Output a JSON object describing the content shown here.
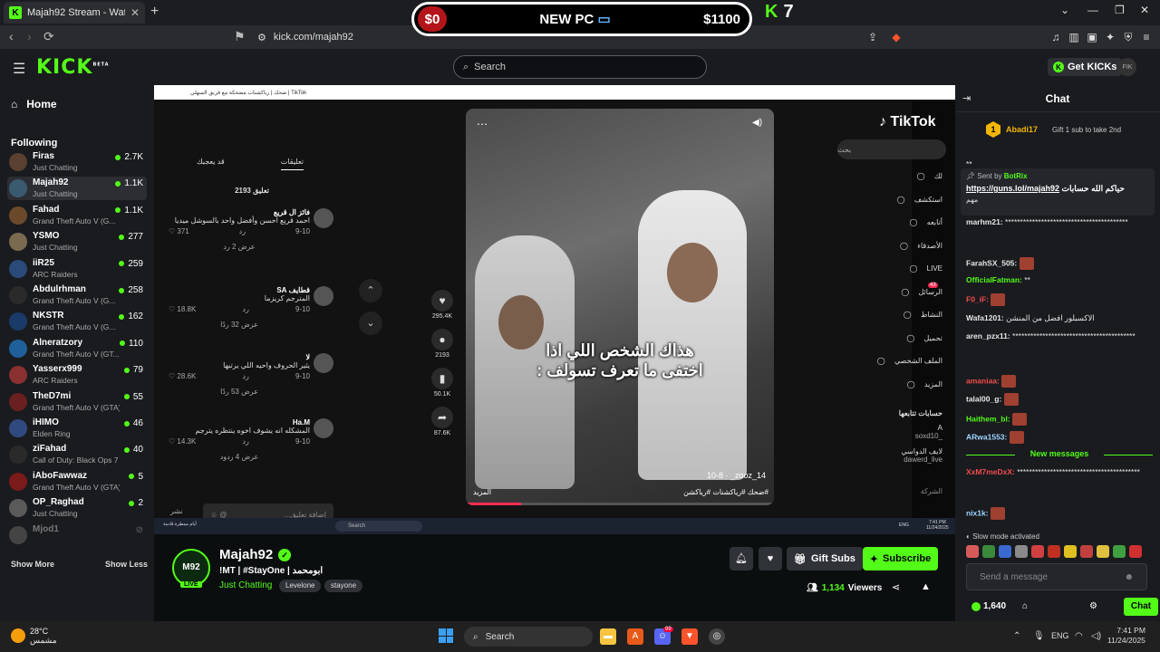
{
  "browser": {
    "tab_title": "Majah92 Stream - Watch Live",
    "tab_close": "✕",
    "new_tab": "+",
    "url": "kick.com/majah92",
    "win_min": "—",
    "win_max": "❐",
    "win_close": "✕",
    "chevron": "⌄"
  },
  "overlay": {
    "left_amount": "$0",
    "middle": "NEW PC",
    "right_amount": "$1100",
    "k_count": "7"
  },
  "header": {
    "logo": "KICK",
    "logo_sup": "BETA",
    "search_placeholder": "Search",
    "get_kicks": "Get KICKs"
  },
  "sidebar": {
    "home": "Home",
    "following": "Following",
    "channels": [
      {
        "name": "Firas",
        "category": "Just Chatting",
        "viewers": "2.7K",
        "live": true
      },
      {
        "name": "Majah92",
        "category": "Just Chatting",
        "viewers": "1.1K",
        "live": true,
        "active": true
      },
      {
        "name": "Fahad",
        "category": "Grand Theft Auto V (G...",
        "viewers": "1.1K",
        "live": true
      },
      {
        "name": "YSMO",
        "category": "Just Chatting",
        "viewers": "277",
        "live": true
      },
      {
        "name": "iiR25",
        "category": "ARC Raiders",
        "viewers": "259",
        "live": true
      },
      {
        "name": "Abdulrhman",
        "category": "Grand Theft Auto V (G...",
        "viewers": "258",
        "live": true
      },
      {
        "name": "NKSTR",
        "category": "Grand Theft Auto V (G...",
        "viewers": "162",
        "live": true
      },
      {
        "name": "Alneratzory",
        "category": "Grand Theft Auto V (GT...",
        "viewers": "110",
        "live": true
      },
      {
        "name": "Yasserx999",
        "category": "ARC Raiders",
        "viewers": "79",
        "live": true
      },
      {
        "name": "TheD7mi",
        "category": "Grand Theft Auto V (GTA)",
        "viewers": "55",
        "live": true
      },
      {
        "name": "iHIMO",
        "category": "Elden Ring",
        "viewers": "46",
        "live": true
      },
      {
        "name": "ziFahad",
        "category": "Call of Duty: Black Ops 7",
        "viewers": "40",
        "live": true
      },
      {
        "name": "iAboFawwaz",
        "category": "Grand Theft Auto V (GTA)",
        "viewers": "5",
        "live": true
      },
      {
        "name": "OP_Raghad",
        "category": "Just Chatting",
        "viewers": "2",
        "live": true
      },
      {
        "name": "Mjod1",
        "category": "",
        "viewers": "",
        "live": false
      }
    ],
    "show_more": "Show More",
    "show_less": "Show Less"
  },
  "stream": {
    "inner_title": "ضحك | رياكشنات مضحكة مع فريق السهلي | TikTok",
    "tiktok": {
      "tab_comments": "تعليقات",
      "tab_liked": "قد يعجبك",
      "comment_count": "2193 تعليق",
      "comments": [
        {
          "user": "فائز ال قريع",
          "text": "احمد قريع احسن وأفضل واحد بالسوشل ميديا",
          "date": "9-10",
          "reply": "رد",
          "likes": "371",
          "replies": "عرض 2 رد"
        },
        {
          "user": "قطايف SA",
          "text": "المترجم كريزما",
          "date": "9-10",
          "reply": "رد",
          "likes": "18.8K",
          "replies": "عرض 32 ردًا"
        },
        {
          "user": "لا",
          "text": "يثير الحروف واحيه اللي يرتبها",
          "date": "9-10",
          "reply": "رد",
          "likes": "28.6K",
          "replies": "عرض 53 ردًا"
        },
        {
          "user": "Ha.M",
          "text": "المشكله انه يشوف اخوه ينتظره يترجم",
          "date": "9-10",
          "reply": "رد",
          "likes": "14.3K",
          "replies": "عرض 4 ردود"
        }
      ],
      "comment_placeholder": "إضافة تعليق...",
      "share_label": "نشر",
      "caption_line1": "هذاك الشخص اللي اذا",
      "caption_line2": "اختفى ما تعرف تسولف :",
      "video_user": "_zooz_14",
      "video_date": "10-8",
      "hashtags": "#ضحك #رياكشنات #رياكشن",
      "more": "المزيد",
      "likes": "295.4K",
      "comments_count": "2193",
      "saves": "50.1K",
      "shares": "87.6K",
      "logo": "TikTok",
      "search": "بحث",
      "nav": [
        "لك",
        "استكشف",
        "أتابعه",
        "الأصدقاء",
        "LIVE",
        "الرسائل",
        "النشاط",
        "تحميل",
        "الملف الشخصي",
        "المزيد"
      ],
      "messages_badge": "43",
      "following_title": "حسابات تتابعها",
      "following_accounts": [
        {
          "name": "A",
          "handle": "_soxd10"
        },
        {
          "name": "لايف الدواسي",
          "handle": "dawerd_live"
        }
      ],
      "company": "الشركة"
    },
    "mini_taskbar": {
      "weather": "أيام ممطرة قادمة",
      "search": "Search",
      "lang": "ENG",
      "time": "7:41 PM",
      "date": "11/24/2025"
    }
  },
  "channel": {
    "avatar_text": "M92",
    "live": "LIVE",
    "name": "Majah92",
    "title": "!MT | #StayOne | ابومحمد",
    "category": "Just Chatting",
    "tags": [
      "Levelone",
      "stayone"
    ],
    "gift_subs": "Gift Subs",
    "subscribe": "Subscribe",
    "viewers": "1,134",
    "viewers_label": "Viewers"
  },
  "chat": {
    "title": "Chat",
    "gifter_rank": "1",
    "gifter_name": "Abadi17",
    "gifter_text": "Gift 1 sub to take 2nd",
    "pinned_by_label": "Sent by",
    "pinned_by": "BotRix",
    "pinned_link": "https://guns.lol/majah92",
    "pinned_text": "حياكم الله حسابات",
    "pinned_extra": "مهم",
    "messages": [
      {
        "user": "",
        "text": "*‌‌‌‌‌‌‌‌‌‌‌‌‌‌‌‌‌‌‌‌‌‌‌‌‌‌‌‌‌‌‌‌‌‌‌‌‌‌‌‌‌‌‌‌‌‌‌‌‌‌*",
        "color": "#e6e6e6"
      },
      {
        "user": "marhm21:",
        "text": "*****************************************",
        "color": "#e6e6e6"
      },
      {
        "user": "FarahSX_505:",
        "text": "",
        "color": "#e6e6e6"
      },
      {
        "user": "OfficialFatman:",
        "text": "*‌‌‌‌‌‌‌‌‌‌‌‌‌‌‌‌‌‌‌*",
        "color": "#53fc18"
      },
      {
        "user": "F0_iF:",
        "text": "",
        "color": "#f14c4c"
      },
      {
        "user": "Wafa1201:",
        "text": "الاكسبلور افضل من المنشن",
        "color": "#e6e6e6"
      },
      {
        "user": "aren_pzx11:",
        "text": "*****************************************",
        "color": "#e6e6e6"
      },
      {
        "user": "amaniaa:",
        "text": "",
        "color": "#f14c4c"
      },
      {
        "user": "talal00_g:",
        "text": "",
        "color": "#e6e6e6"
      },
      {
        "user": "Haithem_bl:",
        "text": "",
        "color": "#53fc18"
      },
      {
        "user": "ARwa1553:",
        "text": "",
        "color": "#9fd6ff"
      }
    ],
    "new_messages": "New messages",
    "after_messages": [
      {
        "user": "XxM7meDxX:",
        "text": "*****************************************",
        "color": "#f14c4c"
      },
      {
        "user": "nix1k:",
        "text": "",
        "color": "#9fd6ff"
      }
    ],
    "slow_mode": "Slow mode activated",
    "input_placeholder": "Send a message",
    "kicks": "1,640",
    "chat_button": "Chat"
  },
  "taskbar": {
    "temp": "28°C",
    "weather": "مشمس",
    "search": "Search",
    "lang": "ENG",
    "time": "7:41 PM",
    "date": "11/24/2025",
    "discord_badge": "99"
  }
}
